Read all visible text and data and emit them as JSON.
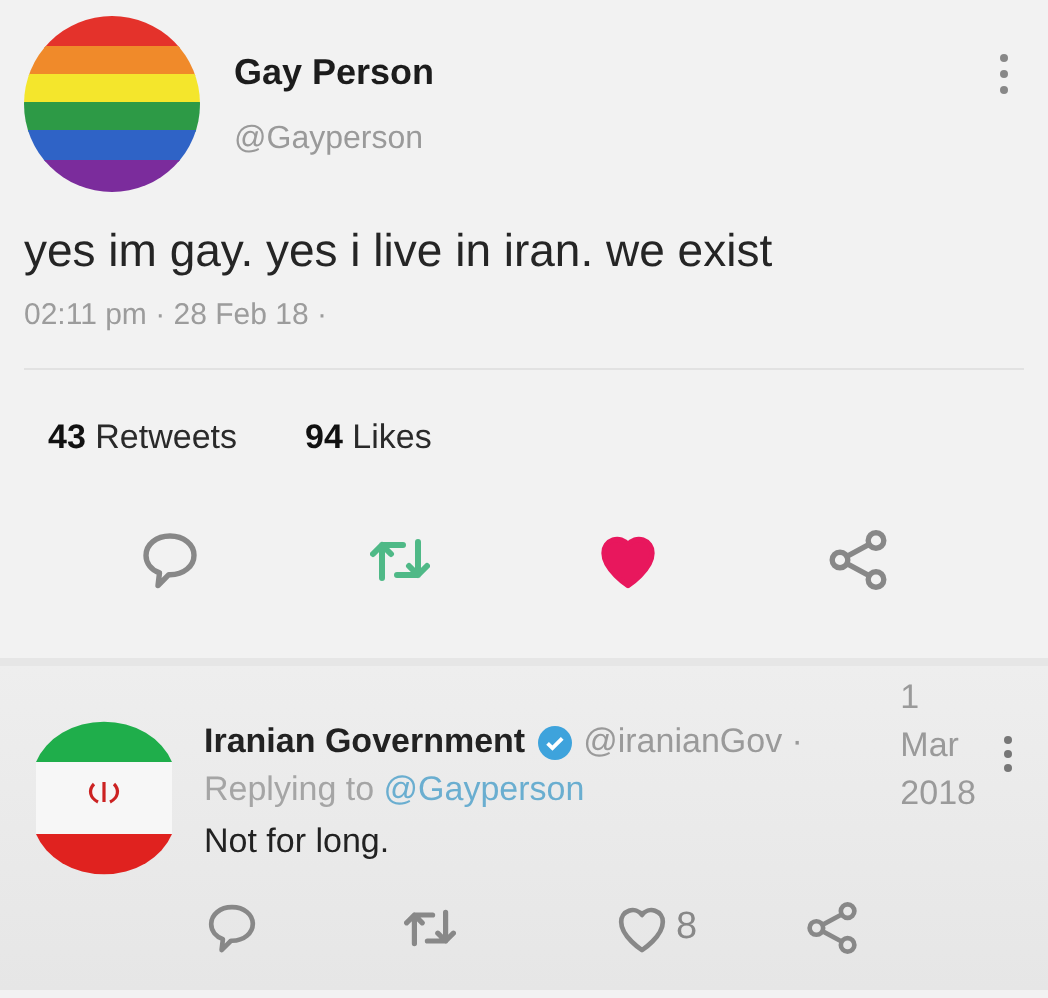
{
  "tweet": {
    "author": {
      "name": "Gay Person",
      "handle": "@Gayperson"
    },
    "text": "yes im gay. yes i live in iran. we exist",
    "timestamp": "02:11 pm · 28 Feb 18 ·",
    "stats": [
      {
        "text": "**43** Retweets"
      },
      {
        "text": "**94** Likes"
      }
    ],
    "actions": [
      {
        "kind": "reply",
        "active": false
      },
      {
        "kind": "retweet",
        "active": true
      },
      {
        "kind": "like",
        "active": true
      },
      {
        "kind": "share",
        "active": false
      }
    ]
  },
  "reply": {
    "author": {
      "name": "Iranian Government",
      "verified": true,
      "handle": "@iranianGov ·"
    },
    "date_lines": [
      "1",
      "Mar",
      "2018"
    ],
    "replying_to": "Replying to",
    "mention": "@Gayperson",
    "text": "Not for long.",
    "actions": [
      {
        "kind": "reply",
        "active": false
      },
      {
        "kind": "retweet",
        "active": false
      },
      {
        "kind": "like",
        "active": false,
        "count": "8"
      },
      {
        "kind": "share",
        "active": false
      }
    ]
  }
}
